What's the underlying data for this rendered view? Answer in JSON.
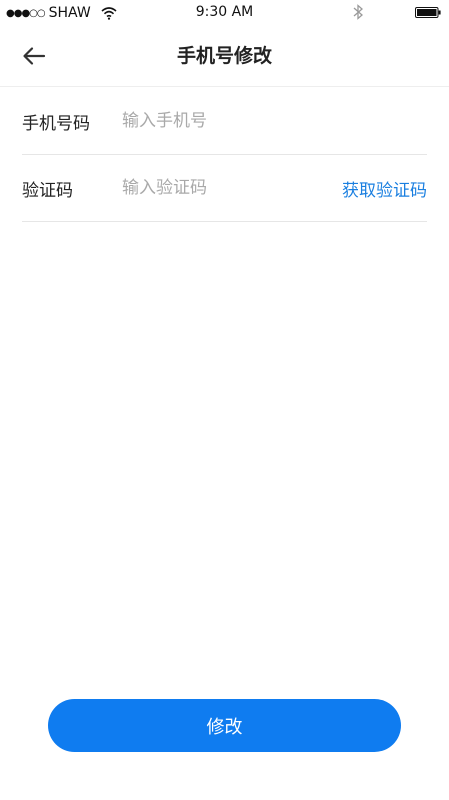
{
  "status_bar": {
    "signal_dots": "●●●○○",
    "carrier": "SHAW",
    "time": "9:30 AM",
    "icons": [
      "wifi-icon",
      "bluetooth-icon",
      "battery-icon"
    ]
  },
  "nav": {
    "title": "手机号修改",
    "back_icon": "arrow-left-icon"
  },
  "form": {
    "phone": {
      "label": "手机号码",
      "value": "",
      "placeholder": "输入手机号"
    },
    "code": {
      "label": "验证码",
      "value": "",
      "placeholder": "输入验证码",
      "action_label": "获取验证码"
    }
  },
  "submit": {
    "label": "修改"
  },
  "colors": {
    "accent": "#0f7cf0",
    "link": "#1a7fe0",
    "placeholder": "#a9a9a9",
    "divider": "#e6e6e6"
  }
}
